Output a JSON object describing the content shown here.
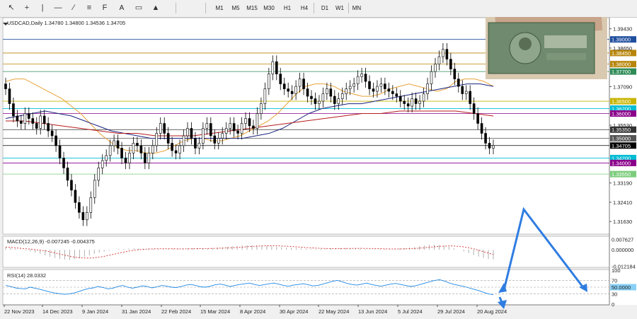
{
  "toolbar": {
    "timeframes": [
      "M1",
      "M5",
      "M15",
      "M30",
      "H1",
      "H4",
      "D1",
      "W1",
      "MN"
    ],
    "text_tool": "A"
  },
  "chart_data": {
    "type": "candlestick",
    "title": "USDCAD,Daily",
    "ohlc": "1.34780 1.34800 1.34536 1.34705",
    "price_ticks": [
      "1.39430",
      "1.38650",
      "1.37090",
      "1.35530",
      "1.33190",
      "1.32410",
      "1.31630"
    ],
    "price_range": [
      1.3115,
      1.3985
    ],
    "level_lines": [
      {
        "label": "1.39000",
        "price": 1.39,
        "color": "#1f4e9e"
      },
      {
        "label": "1.38450",
        "price": 1.3845,
        "color": "#b8860b"
      },
      {
        "label": "1.38000",
        "price": 1.38,
        "color": "#b8860b"
      },
      {
        "label": "1.37700",
        "price": 1.377,
        "color": "#2e8b57"
      },
      {
        "label": "1.36500",
        "price": 1.365,
        "color": "#c8b400"
      },
      {
        "label": "1.36200",
        "price": 1.362,
        "color": "#00bcd4"
      },
      {
        "label": "1.36000",
        "price": 1.36,
        "color": "#8b008b"
      },
      {
        "label": "1.35350",
        "price": 1.3535,
        "color": "#333333"
      },
      {
        "label": "1.35000",
        "price": 1.35,
        "color": "#555555"
      },
      {
        "label": "1.34705",
        "price": 1.34705,
        "color": "#000000"
      },
      {
        "label": "1.34200",
        "price": 1.342,
        "color": "#00bcd4"
      },
      {
        "label": "1.34000",
        "price": 1.34,
        "color": "#8b008b"
      },
      {
        "label": "1.33550",
        "price": 1.3355,
        "color": "#7ccd7c"
      }
    ],
    "x_labels": [
      "22 Nov 2023",
      "14 Dec 2023",
      "9 Jan 2024",
      "31 Jan 2024",
      "22 Feb 2024",
      "15 Mar 2024",
      "8 Apr 2024",
      "30 Apr 2024",
      "22 May 2024",
      "13 Jun 2024",
      "5 Jul 2024",
      "29 Jul 2024",
      "20 Aug 2024"
    ],
    "closes": [
      1.37,
      1.364,
      1.359,
      1.357,
      1.356,
      1.36,
      1.358,
      1.356,
      1.354,
      1.359,
      1.356,
      1.353,
      1.351,
      1.347,
      1.342,
      1.338,
      1.333,
      1.329,
      1.324,
      1.32,
      1.317,
      1.32,
      1.326,
      1.333,
      1.338,
      1.341,
      1.343,
      1.347,
      1.349,
      1.346,
      1.342,
      1.34,
      1.344,
      1.348,
      1.347,
      1.344,
      1.34,
      1.344,
      1.347,
      1.352,
      1.356,
      1.352,
      1.348,
      1.345,
      1.344,
      1.347,
      1.351,
      1.354,
      1.35,
      1.346,
      1.348,
      1.354,
      1.356,
      1.351,
      1.348,
      1.35,
      1.352,
      1.354,
      1.356,
      1.353,
      1.352,
      1.356,
      1.358,
      1.355,
      1.354,
      1.36,
      1.364,
      1.37,
      1.376,
      1.381,
      1.376,
      1.372,
      1.37,
      1.369,
      1.368,
      1.371,
      1.374,
      1.37,
      1.367,
      1.366,
      1.364,
      1.365,
      1.368,
      1.37,
      1.367,
      1.364,
      1.366,
      1.368,
      1.37,
      1.371,
      1.372,
      1.375,
      1.376,
      1.373,
      1.37,
      1.369,
      1.371,
      1.372,
      1.37,
      1.369,
      1.368,
      1.367,
      1.365,
      1.364,
      1.363,
      1.366,
      1.364,
      1.365,
      1.368,
      1.372,
      1.377,
      1.38,
      1.383,
      1.386,
      1.382,
      1.378,
      1.374,
      1.371,
      1.368,
      1.369,
      1.364,
      1.36,
      1.356,
      1.352,
      1.348,
      1.346,
      1.347
    ],
    "ma": [
      {
        "color": "#e8a33a",
        "values": [
          1.373,
          1.374,
          1.374,
          1.372,
          1.37,
          1.368,
          1.366,
          1.363,
          1.36,
          1.356,
          1.352,
          1.349,
          1.346,
          1.345,
          1.345,
          1.344,
          1.344,
          1.345,
          1.347,
          1.349,
          1.35,
          1.35,
          1.349,
          1.349,
          1.35,
          1.351,
          1.353,
          1.355,
          1.357,
          1.36,
          1.364,
          1.368,
          1.371,
          1.372,
          1.372,
          1.371,
          1.369,
          1.368,
          1.367,
          1.367,
          1.368,
          1.37,
          1.371,
          1.372,
          1.371,
          1.37,
          1.369,
          1.37,
          1.373,
          1.374,
          1.374,
          1.373,
          1.371
        ]
      },
      {
        "color": "#1a237e",
        "values": [
          1.358,
          1.359,
          1.36,
          1.361,
          1.36,
          1.359,
          1.357,
          1.355,
          1.353,
          1.352,
          1.351,
          1.35,
          1.35,
          1.35,
          1.35,
          1.35,
          1.35,
          1.35,
          1.35,
          1.351,
          1.352,
          1.354,
          1.357,
          1.36,
          1.362,
          1.363,
          1.364,
          1.364,
          1.365,
          1.366,
          1.367,
          1.368,
          1.369,
          1.37,
          1.371,
          1.372,
          1.372,
          1.371
        ]
      },
      {
        "color": "#b71c1c",
        "values": [
          1.357,
          1.357,
          1.356,
          1.355,
          1.354,
          1.353,
          1.352,
          1.352,
          1.351,
          1.351,
          1.351,
          1.352,
          1.353,
          1.354,
          1.355,
          1.356,
          1.357,
          1.358,
          1.359,
          1.36,
          1.36,
          1.361,
          1.361,
          1.361,
          1.361,
          1.36,
          1.359
        ]
      }
    ],
    "macd": {
      "label": "MACD(12,26,9) -0.007245 -0.004375",
      "ticks": [
        "0.007627",
        "0.000000",
        "-0.012184"
      ],
      "range": [
        -0.0125,
        0.0095
      ],
      "hist": [
        0.002,
        0.0015,
        0.0008,
        0.0002,
        -0.0005,
        -0.0012,
        -0.002,
        -0.003,
        -0.004,
        -0.0052,
        -0.006,
        -0.0068,
        -0.0072,
        -0.0075,
        -0.007,
        -0.0062,
        -0.0052,
        -0.0042,
        -0.003,
        -0.002,
        -0.0012,
        -0.0005,
        0.0,
        0.0004,
        0.0007,
        0.0009,
        0.001,
        0.001,
        0.0009,
        0.0008,
        0.0006,
        0.0005,
        0.0005,
        0.0006,
        0.0007,
        0.0008,
        0.0009,
        0.0011,
        0.0012,
        0.0012,
        0.0011,
        0.001,
        0.0012,
        0.0015,
        0.0018,
        0.0022,
        0.0026,
        0.0029,
        0.0032,
        0.0034,
        0.0034,
        0.0032,
        0.003,
        0.0027,
        0.0024,
        0.0021,
        0.0018,
        0.0016,
        0.0014,
        0.0012,
        0.001,
        0.0008,
        0.0006,
        0.0006,
        0.0007,
        0.0009,
        0.0011,
        0.0013,
        0.0014,
        0.0013,
        0.0011,
        0.0009,
        0.0007,
        0.0005,
        0.0004,
        0.0004,
        0.0005,
        0.0006,
        0.0007,
        0.0008,
        0.001,
        0.0012,
        0.0015,
        0.002,
        0.0026,
        0.0032,
        0.0036,
        0.0038,
        0.0036,
        0.003,
        0.0022,
        0.0012,
        0.0,
        -0.0012,
        -0.0025,
        -0.0038,
        -0.005,
        -0.006,
        -0.0068,
        -0.0072
      ]
    },
    "rsi": {
      "label": "RSI(14) 28.0332",
      "ticks": [
        "100",
        "70",
        "50.0000",
        "30",
        "0"
      ],
      "levels": [
        70,
        50,
        30
      ],
      "values": [
        55,
        52,
        48,
        46,
        45,
        50,
        47,
        44,
        40,
        36,
        33,
        31,
        29,
        30,
        33,
        37,
        42,
        46,
        48,
        52,
        49,
        45,
        47,
        52,
        55,
        50,
        47,
        50,
        54,
        52,
        48,
        51,
        55,
        53,
        50,
        49,
        52,
        56,
        58,
        55,
        51,
        50,
        53,
        57,
        59,
        56,
        52,
        55,
        58,
        60,
        62,
        58,
        55,
        57,
        60,
        62,
        59,
        55,
        53,
        56,
        58,
        60,
        57,
        54,
        55,
        59,
        63,
        67,
        70,
        66,
        61,
        58,
        56,
        59,
        62,
        58,
        55,
        53,
        56,
        59,
        61,
        58,
        55,
        52,
        54,
        58,
        62,
        66,
        70,
        72,
        68,
        62,
        58,
        55,
        52,
        48,
        44,
        40,
        35,
        30,
        28
      ]
    }
  }
}
